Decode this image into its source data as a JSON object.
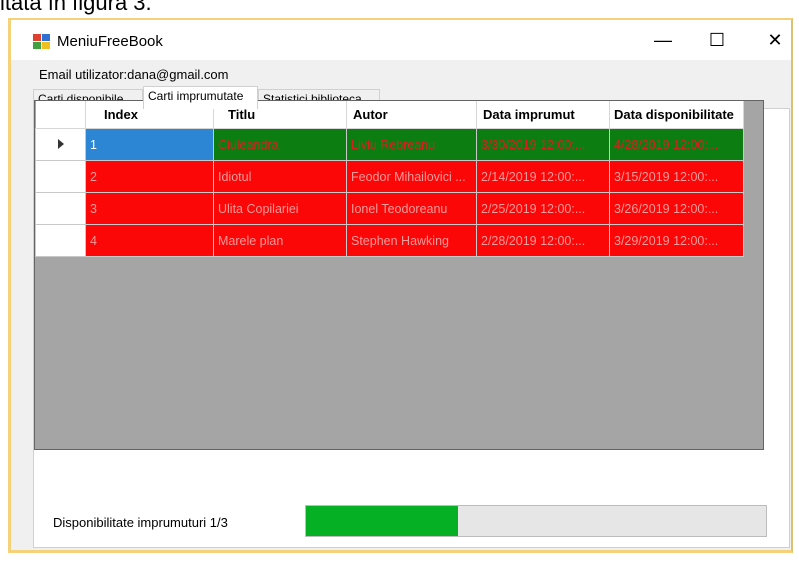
{
  "background_text": "itată în figura 3.",
  "window": {
    "title": "MeniuFreeBook",
    "min_symbol": "—",
    "max_symbol": "☐",
    "close_symbol": "✕"
  },
  "email_label": "Email utilizator:dana@gmail.com",
  "tabs": [
    {
      "label": "Carti disponibile",
      "active": false
    },
    {
      "label": "Carti imprumutate",
      "active": true
    },
    {
      "label": "Statistici biblioteca",
      "active": false
    }
  ],
  "table": {
    "columns": [
      "Index",
      "Titlu",
      "Autor",
      "Data imprumut",
      "Data disponibilitate"
    ],
    "rows": [
      {
        "index": "1",
        "titlu": "Ciuleandra",
        "autor": "Liviu Rebreanu",
        "data_imprumut": "3/30/2019 12:00:...",
        "data_disponibilitate": "4/28/2019 12:00:...",
        "status": "green",
        "selected": true
      },
      {
        "index": "2",
        "titlu": "Idiotul",
        "autor": "Feodor Mihailovici ...",
        "data_imprumut": "2/14/2019 12:00:...",
        "data_disponibilitate": "3/15/2019 12:00:...",
        "status": "red",
        "selected": false
      },
      {
        "index": "3",
        "titlu": "Ulita Copilariei",
        "autor": "Ionel Teodoreanu",
        "data_imprumut": "2/25/2019 12:00:...",
        "data_disponibilitate": "3/26/2019 12:00:...",
        "status": "red",
        "selected": false
      },
      {
        "index": "4",
        "titlu": "Marele plan",
        "autor": "Stephen Hawking",
        "data_imprumut": "2/28/2019 12:00:...",
        "data_disponibilitate": "3/29/2019 12:00:...",
        "status": "red",
        "selected": false
      }
    ]
  },
  "progress": {
    "label": "Disponibilitate imprumuturi 1/3",
    "value": 0.33,
    "color": "#06b025"
  },
  "colors": {
    "row_green": "#0c7d10",
    "row_red": "#fb0707",
    "selection": "#2d86d4",
    "grid_empty": "#a5a5a5"
  }
}
